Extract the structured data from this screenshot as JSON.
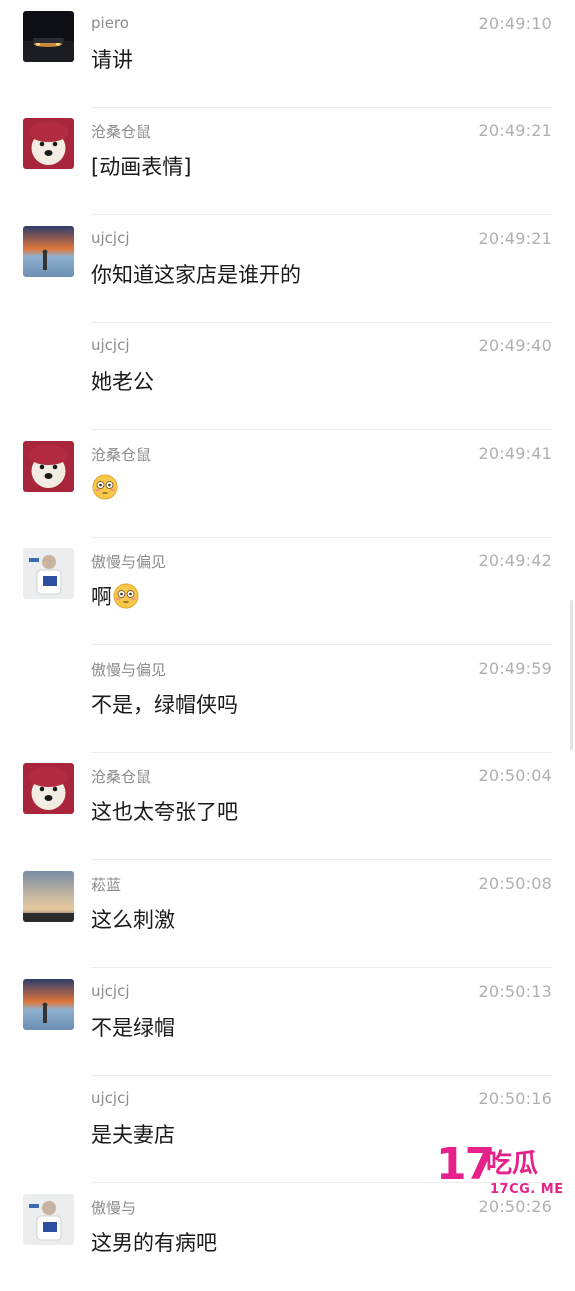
{
  "messages": [
    {
      "sender": "piero",
      "time": "20:49:10",
      "text": "请讲",
      "avatar": "car-night-avatar",
      "show_avatar": true
    },
    {
      "sender": "沧桑仓鼠",
      "time": "20:49:21",
      "text": "[动画表情]",
      "avatar": "dog-avatar",
      "show_avatar": true
    },
    {
      "sender": "ujcjcj",
      "time": "20:49:21",
      "text": "你知道这家店是谁开的",
      "avatar": "sunset-avatar",
      "show_avatar": true
    },
    {
      "sender": "ujcjcj",
      "time": "20:49:40",
      "text": "她老公",
      "avatar": "",
      "show_avatar": false
    },
    {
      "sender": "沧桑仓鼠",
      "time": "20:49:41",
      "text": "",
      "avatar": "dog-avatar",
      "show_avatar": true,
      "emoji": "flushed-face-emoji"
    },
    {
      "sender": "傲慢与偏见",
      "time": "20:49:42",
      "text": "啊",
      "avatar": "person-avatar",
      "show_avatar": true,
      "emoji": "flushed-face-emoji"
    },
    {
      "sender": "傲慢与偏见",
      "time": "20:49:59",
      "text": "不是，绿帽侠吗",
      "avatar": "",
      "show_avatar": false
    },
    {
      "sender": "沧桑仓鼠",
      "time": "20:50:04",
      "text": "这也太夸张了吧",
      "avatar": "dog-avatar",
      "show_avatar": true
    },
    {
      "sender": "菘蓝",
      "time": "20:50:08",
      "text": "这么刺激",
      "avatar": "sky-avatar",
      "show_avatar": true
    },
    {
      "sender": "ujcjcj",
      "time": "20:50:13",
      "text": "不是绿帽",
      "avatar": "sunset-avatar",
      "show_avatar": true
    },
    {
      "sender": "ujcjcj",
      "time": "20:50:16",
      "text": "是夫妻店",
      "avatar": "",
      "show_avatar": false
    },
    {
      "sender": "傲慢与",
      "time": "20:50:26",
      "text": "这男的有病吧",
      "avatar": "person-avatar",
      "show_avatar": true
    }
  ],
  "watermark": {
    "big": "17",
    "cn": "吃瓜",
    "small": "17CG. ME"
  },
  "colors": {
    "name": "#8c8c8c",
    "time": "#b0b0b0",
    "text": "#1a1a1a",
    "divider": "#ececec",
    "watermark": "#e6228a"
  }
}
